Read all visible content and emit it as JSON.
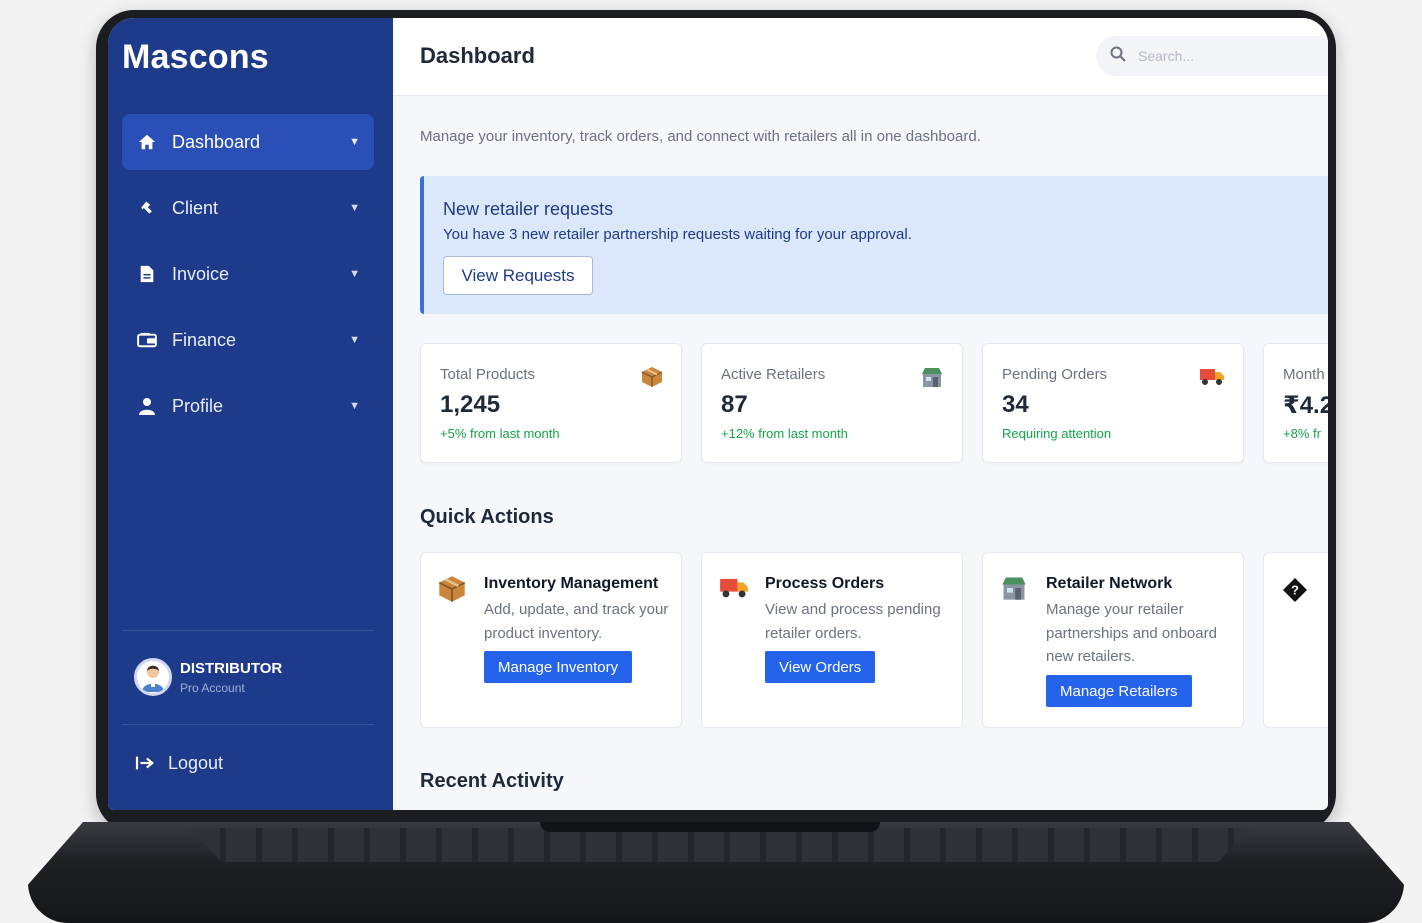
{
  "app": {
    "brand": "Mascons"
  },
  "sidebar": {
    "items": [
      {
        "label": "Dashboard",
        "icon": "home-icon"
      },
      {
        "label": "Client",
        "icon": "client-icon"
      },
      {
        "label": "Invoice",
        "icon": "document-icon"
      },
      {
        "label": "Finance",
        "icon": "wallet-icon"
      },
      {
        "label": "Profile",
        "icon": "user-icon"
      }
    ],
    "user": {
      "role": "DISTRIBUTOR",
      "account": "Pro Account"
    },
    "logout_label": "Logout"
  },
  "header": {
    "title": "Dashboard",
    "search_placeholder": "Search..."
  },
  "main": {
    "subtitle": "Manage your inventory, track orders, and connect with retailers all in one dashboard.",
    "alert": {
      "title": "New retailer requests",
      "text": "You have 3 new retailer partnership requests waiting for your approval.",
      "button": "View Requests"
    },
    "stats": [
      {
        "label": "Total Products",
        "value": "1,245",
        "delta": "+5% from last month",
        "icon": "box-icon",
        "delta_color": "#16a34a"
      },
      {
        "label": "Active Retailers",
        "value": "87",
        "delta": "+12% from last month",
        "icon": "store-icon",
        "delta_color": "#16a34a"
      },
      {
        "label": "Pending Orders",
        "value": "34",
        "delta": "Requiring attention",
        "icon": "truck-icon",
        "delta_color": "#16a34a"
      },
      {
        "label": "Month",
        "value": "₹4.2",
        "delta": "+8% fr",
        "icon": "",
        "delta_color": "#16a34a"
      }
    ],
    "quick_actions_title": "Quick Actions",
    "actions": [
      {
        "title": "Inventory Management",
        "desc": "Add, update, and track your product inventory.",
        "button": "Manage Inventory",
        "icon": "box-icon"
      },
      {
        "title": "Process Orders",
        "desc": "View and process pending retailer orders.",
        "button": "View Orders",
        "icon": "truck-icon"
      },
      {
        "title": "Retailer Network",
        "desc": "Manage your retailer partnerships and onboard new retailers.",
        "button": "Manage Retailers",
        "icon": "store-icon"
      },
      {
        "title": "",
        "desc": "",
        "button": "",
        "icon": "help-diamond-icon"
      }
    ],
    "recent_activity_title": "Recent Activity"
  },
  "colors": {
    "sidebar_bg": "#1e3a8a",
    "sidebar_active": "#2a4fb6",
    "primary_button": "#2563eb",
    "alert_bg": "#dbe7fb",
    "positive": "#16a34a"
  }
}
